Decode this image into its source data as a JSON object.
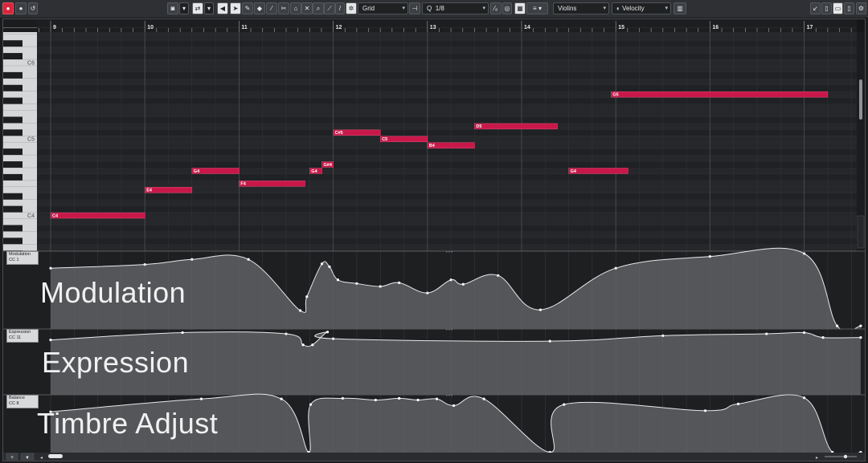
{
  "toolbar": {
    "snap_mode": "Grid",
    "quantize_prefix": "Q",
    "quantize_value": "1/8",
    "track": "Violins",
    "velocity_lane": "Velocity",
    "quantize_glyph": "⁄₈"
  },
  "ruler": {
    "bars": [
      "9",
      "10",
      "11",
      "12",
      "13",
      "14",
      "15",
      "16",
      "17"
    ]
  },
  "keyboard": {
    "labels": [
      "C6",
      "C5",
      "C4"
    ]
  },
  "notes": [
    {
      "name": "C4",
      "pitch": 60,
      "start": 9.0,
      "end": 10.0
    },
    {
      "name": "E4",
      "pitch": 64,
      "start": 10.0,
      "end": 10.5
    },
    {
      "name": "G4",
      "pitch": 67,
      "start": 10.5,
      "end": 11.0
    },
    {
      "name": "F4",
      "pitch": 65,
      "start": 11.0,
      "end": 11.7
    },
    {
      "name": "G4",
      "pitch": 67,
      "start": 11.75,
      "end": 11.88
    },
    {
      "name": "G#4",
      "pitch": 68,
      "start": 11.88,
      "end": 12.0
    },
    {
      "name": "C#5",
      "pitch": 73,
      "start": 12.0,
      "end": 12.5
    },
    {
      "name": "C5",
      "pitch": 72,
      "start": 12.5,
      "end": 13.0
    },
    {
      "name": "B4",
      "pitch": 71,
      "start": 13.0,
      "end": 13.5
    },
    {
      "name": "D5",
      "pitch": 74,
      "start": 13.5,
      "end": 14.38
    },
    {
      "name": "G4",
      "pitch": 67,
      "start": 14.5,
      "end": 15.13
    },
    {
      "name": "G5",
      "pitch": 79,
      "start": 14.95,
      "end": 17.25
    }
  ],
  "lanes": [
    {
      "title": "Modulation",
      "cc": "CC 1",
      "label": "Modulation",
      "points": [
        [
          9,
          0.8
        ],
        [
          10,
          0.85
        ],
        [
          10.5,
          0.92
        ],
        [
          11.1,
          0.92
        ],
        [
          11.65,
          0.22
        ],
        [
          11.72,
          0.41
        ],
        [
          11.88,
          0.86
        ],
        [
          11.96,
          0.82
        ],
        [
          12.05,
          0.64
        ],
        [
          12.25,
          0.59
        ],
        [
          12.5,
          0.55
        ],
        [
          12.7,
          0.6
        ],
        [
          13.0,
          0.46
        ],
        [
          13.25,
          0.64
        ],
        [
          13.38,
          0.58
        ],
        [
          13.75,
          0.7
        ],
        [
          14.2,
          0.23
        ],
        [
          15.0,
          0.8
        ],
        [
          16.0,
          0.96
        ],
        [
          17.0,
          1.0
        ],
        [
          17.35,
          0.01
        ],
        [
          17.6,
          0.01
        ]
      ]
    },
    {
      "title": "Expression",
      "cc": "CC 11",
      "label": "Expression",
      "points": [
        [
          9,
          0.86
        ],
        [
          10.4,
          0.98
        ],
        [
          11.5,
          0.96
        ],
        [
          11.68,
          0.78
        ],
        [
          11.78,
          0.78
        ],
        [
          11.94,
          0.99
        ],
        [
          12.0,
          0.88
        ],
        [
          14.3,
          0.84
        ],
        [
          15.5,
          0.93
        ],
        [
          16.6,
          0.96
        ],
        [
          17.0,
          0.98
        ],
        [
          17.2,
          0.9
        ],
        [
          17.6,
          0.9
        ]
      ]
    },
    {
      "title": "Balance",
      "cc": "CC 8",
      "label": "Timbre Adjust",
      "points": [
        [
          9,
          0.74
        ],
        [
          10.6,
          0.97
        ],
        [
          11.45,
          0.97
        ],
        [
          11.74,
          0.02
        ],
        [
          11.76,
          0.87
        ],
        [
          12.1,
          0.98
        ],
        [
          12.45,
          0.95
        ],
        [
          12.7,
          0.98
        ],
        [
          12.9,
          0.95
        ],
        [
          13.1,
          0.97
        ],
        [
          13.28,
          0.85
        ],
        [
          13.6,
          0.97
        ],
        [
          14.3,
          0.02
        ],
        [
          14.45,
          0.87
        ],
        [
          15.95,
          0.76
        ],
        [
          16.3,
          0.88
        ],
        [
          17.0,
          0.99
        ],
        [
          17.3,
          0.02
        ],
        [
          17.6,
          0.02
        ]
      ]
    }
  ]
}
